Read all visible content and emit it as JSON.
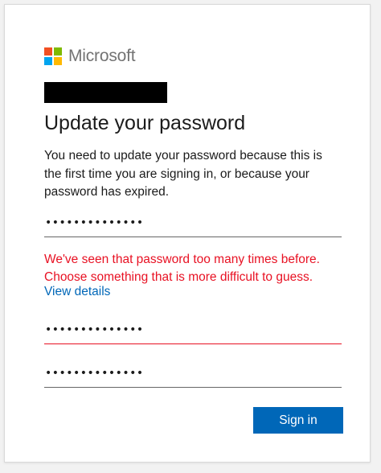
{
  "brand": {
    "name": "Microsoft",
    "logo_colors": [
      "#f25022",
      "#7fba00",
      "#00a4ef",
      "#ffb900"
    ]
  },
  "page": {
    "title": "Update your password",
    "description": "You need to update your password because this is the first time you are signing in, or because your password has expired."
  },
  "fields": {
    "current_password": "••••••••••••••",
    "new_password": "••••••••••••••",
    "confirm_password": "••••••••••••••"
  },
  "error": {
    "message": "We've seen that password too many times before. Choose something that is more difficult to guess.",
    "link_label": "View details",
    "color": "#e81123"
  },
  "actions": {
    "sign_in_label": "Sign in",
    "accent_color": "#0067b8"
  }
}
